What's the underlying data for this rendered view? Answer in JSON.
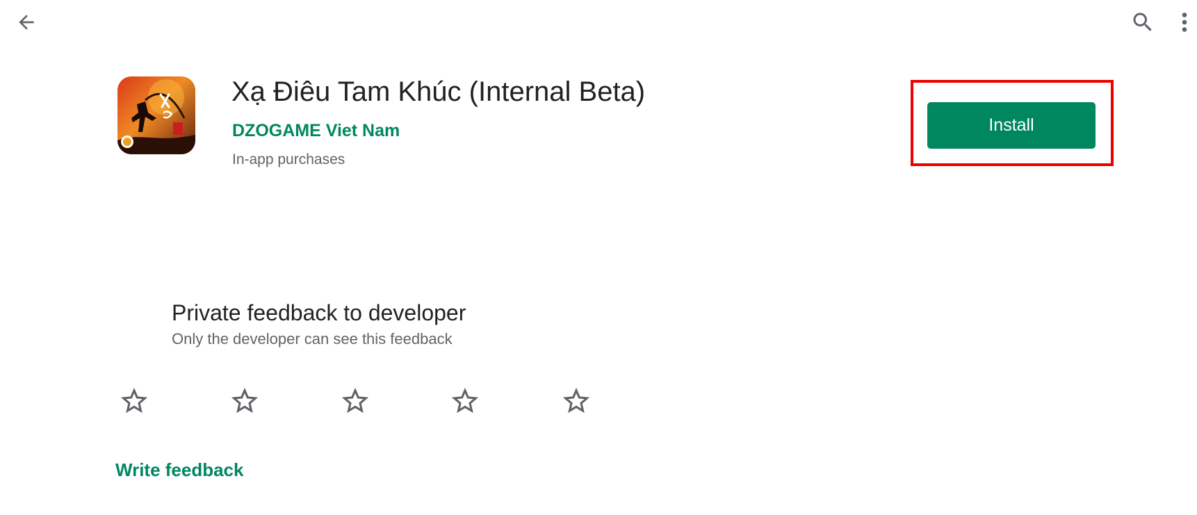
{
  "topbar": {
    "back_icon": "arrow-back-icon",
    "search_icon": "search-icon",
    "more_icon": "more-vert-icon"
  },
  "app": {
    "title": "Xạ Điêu Tam Khúc (Internal Beta)",
    "developer": "DZOGAME Viet Nam",
    "iap_label": "In-app purchases",
    "install_label": "Install",
    "accent_color": "#01875f",
    "highlight_color": "#ee0000"
  },
  "feedback": {
    "title": "Private feedback to developer",
    "subtitle": "Only the developer can see this feedback",
    "star_icon": "star-outline-icon",
    "stars_total": 5,
    "stars_selected": 0,
    "write_label": "Write feedback"
  }
}
